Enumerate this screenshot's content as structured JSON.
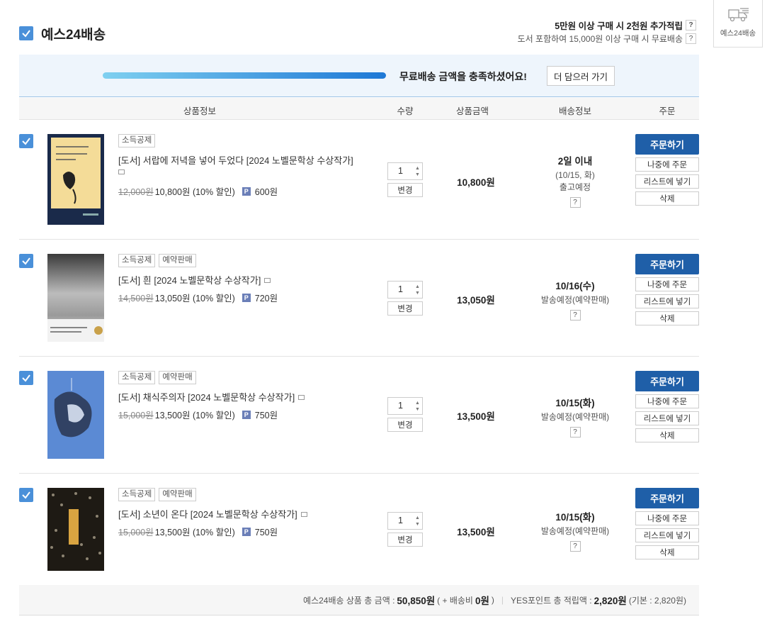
{
  "header": {
    "title": "예스24배송",
    "info_line1": "5만원 이상 구매 시 2천원 추가적립",
    "info_line2": "도서 포함하여 15,000원 이상 구매 시 무료배송",
    "help": "?"
  },
  "side": {
    "label": "예스24배송"
  },
  "banner": {
    "message": "무료배송 금액을 충족하셨어요!",
    "button": "더 담으러 가기",
    "progress": 1.0
  },
  "table_header": {
    "product": "상품정보",
    "qty": "수량",
    "amount": "상품금액",
    "ship": "배송정보",
    "order": "주문"
  },
  "items": [
    {
      "tags": [
        "소득공제"
      ],
      "title": "[도서] 서랍에 저녁을 넣어 두었다 [2024 노벨문학상 수상작가]",
      "orig": "12,000원",
      "sale": "10,800원 (10% 할인)",
      "point_badge": "P",
      "points": "600원",
      "qty": "1",
      "change": "변경",
      "amount": "10,800원",
      "ship_date": "2일 이내",
      "ship_sub1": "(10/15, 화)",
      "ship_sub2": "출고예정",
      "help": "?",
      "order": "주문하기",
      "later": "나중에 주문",
      "list": "리스트에 넣기",
      "del": "삭제"
    },
    {
      "tags": [
        "소득공제",
        "예약판매"
      ],
      "title": "[도서] 흰 [2024 노벨문학상 수상작가]",
      "orig": "14,500원",
      "sale": "13,050원 (10% 할인)",
      "point_badge": "P",
      "points": "720원",
      "qty": "1",
      "change": "변경",
      "amount": "13,050원",
      "ship_date": "10/16(수)",
      "ship_sub1": "발송예정(예약판매)",
      "help": "?",
      "order": "주문하기",
      "later": "나중에 주문",
      "list": "리스트에 넣기",
      "del": "삭제"
    },
    {
      "tags": [
        "소득공제",
        "예약판매"
      ],
      "title": "[도서] 채식주의자 [2024 노벨문학상 수상작가]",
      "orig": "15,000원",
      "sale": "13,500원 (10% 할인)",
      "point_badge": "P",
      "points": "750원",
      "qty": "1",
      "change": "변경",
      "amount": "13,500원",
      "ship_date": "10/15(화)",
      "ship_sub1": "발송예정(예약판매)",
      "help": "?",
      "order": "주문하기",
      "later": "나중에 주문",
      "list": "리스트에 넣기",
      "del": "삭제"
    },
    {
      "tags": [
        "소득공제",
        "예약판매"
      ],
      "title": "[도서] 소년이 온다 [2024 노벨문학상 수상작가]",
      "orig": "15,000원",
      "sale": "13,500원 (10% 할인)",
      "point_badge": "P",
      "points": "750원",
      "qty": "1",
      "change": "변경",
      "amount": "13,500원",
      "ship_date": "10/15(화)",
      "ship_sub1": "발송예정(예약판매)",
      "help": "?",
      "order": "주문하기",
      "later": "나중에 주문",
      "list": "리스트에 넣기",
      "del": "삭제"
    }
  ],
  "footer": {
    "total_label": "예스24배송 상품 총 금액 :",
    "total": "50,850원",
    "ship_open": "( + 배송비",
    "ship_fee": "0원",
    "ship_close": ")",
    "points_label": "YES포인트 총 적립액 :",
    "points_total": "2,820원",
    "points_base": "(기본 : 2,820원)"
  },
  "colors": {
    "accent": "#4a90d9",
    "order_button": "#1f5fa8",
    "banner_bg": "#eef5fc"
  }
}
